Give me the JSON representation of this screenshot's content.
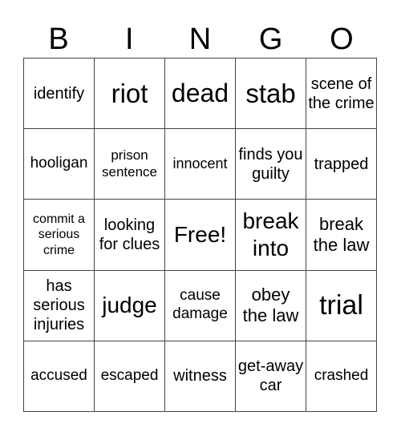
{
  "header": [
    "B",
    "I",
    "N",
    "G",
    "O"
  ],
  "cells": [
    "identify",
    "riot",
    "dead",
    "stab",
    "scene of the crime",
    "hooligan",
    "prison sentence",
    "innocent",
    "finds you guilty",
    "trapped",
    "commit a serious crime",
    "looking for clues",
    "Free!",
    "break into",
    "break the law",
    "has serious injuries",
    "judge",
    "cause damage",
    "obey the law",
    "trial",
    "accused",
    "escaped",
    "witness",
    "get-away car",
    "crashed"
  ]
}
